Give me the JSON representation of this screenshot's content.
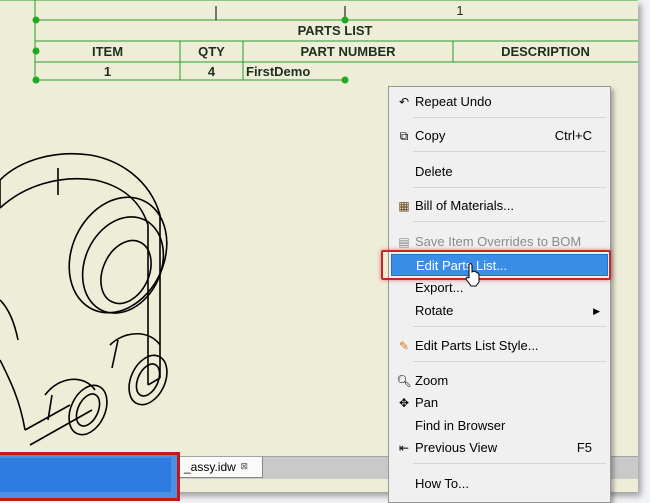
{
  "parts_list": {
    "top_number": "1",
    "title": "PARTS LIST",
    "headers": [
      "ITEM",
      "QTY",
      "PART NUMBER",
      "DESCRIPTION"
    ],
    "rows": [
      {
        "item": "1",
        "qty": "4",
        "part_number": "FirstDemo",
        "description": ""
      }
    ]
  },
  "context_menu": {
    "items": [
      {
        "icon": "undo-arrow-icon",
        "label": "Repeat Undo",
        "shortcut": "",
        "disabled": false
      },
      {
        "icon": "copy-icon",
        "label": "Copy",
        "shortcut": "Ctrl+C",
        "disabled": false
      },
      {
        "icon": "",
        "label": "Delete",
        "shortcut": "",
        "disabled": false
      },
      {
        "icon": "bill-of-materials-icon",
        "label": "Bill of Materials...",
        "shortcut": "",
        "disabled": false
      },
      {
        "icon": "save-overrides-icon",
        "label": "Save Item Overrides to BOM",
        "shortcut": "",
        "disabled": true
      },
      {
        "icon": "",
        "label": "Edit Parts List...",
        "shortcut": "",
        "disabled": false,
        "highlighted": true
      },
      {
        "icon": "",
        "label": "Export...",
        "shortcut": "",
        "disabled": false
      },
      {
        "icon": "",
        "label": "Rotate",
        "shortcut": "",
        "disabled": false,
        "submenu": true
      },
      {
        "icon": "style-icon",
        "label": "Edit Parts List Style...",
        "shortcut": "",
        "disabled": false
      },
      {
        "icon": "zoom-icon",
        "label": "Zoom",
        "shortcut": "",
        "disabled": false
      },
      {
        "icon": "pan-icon",
        "label": "Pan",
        "shortcut": "",
        "disabled": false
      },
      {
        "icon": "",
        "label": "Find in Browser",
        "shortcut": "",
        "disabled": false
      },
      {
        "icon": "previous-view-icon",
        "label": "Previous View",
        "shortcut": "F5",
        "disabled": false
      },
      {
        "icon": "",
        "label": "How To...",
        "shortcut": "",
        "disabled": false
      }
    ]
  },
  "tabs": {
    "doc_tab_label": "_assy.idw"
  },
  "colors": {
    "sheet": "#eeedd8",
    "table_lines": "#2a9a2a",
    "highlight": "#3a8ee8",
    "callout": "#c0282b"
  }
}
